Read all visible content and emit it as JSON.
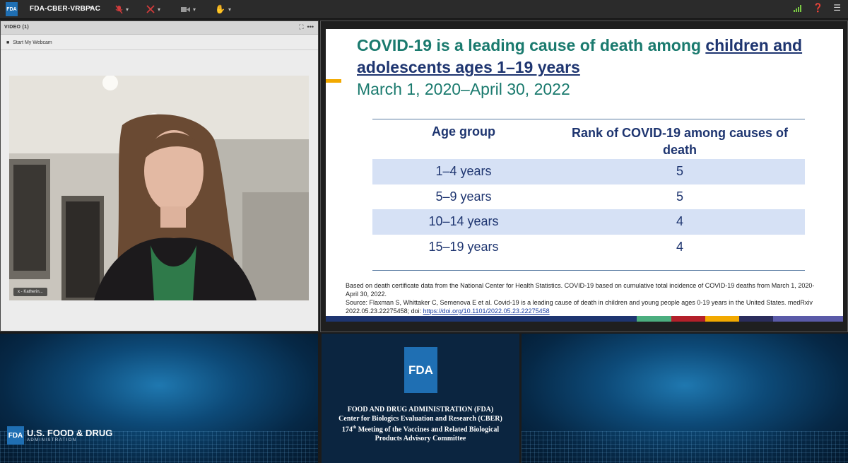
{
  "toolbar": {
    "room_name": "FDA-CBER-VRBPAC",
    "logo_text": "FDA",
    "icons": [
      "mic-muted-icon",
      "camera-muted-icon",
      "webcam-icon",
      "raise-hand-icon",
      "signal-icon",
      "help-icon",
      "menu-icon"
    ]
  },
  "video_pod": {
    "title": "VIDEO (1)",
    "start_webcam": "Start My Webcam",
    "speaker_name": "x - Katherin..."
  },
  "slide": {
    "title_part1": "COVID-19 is a leading cause of death among ",
    "title_part2": "children and adolescents ages 1–19 years",
    "subtitle": "March 1, 2020–April 30, 2022",
    "table": {
      "headers": [
        "Age group",
        "Rank of COVID-19 among causes of death"
      ],
      "rows": [
        [
          "1–4 years",
          "5"
        ],
        [
          "5–9 years",
          "5"
        ],
        [
          "10–14 years",
          "4"
        ],
        [
          "15–19 years",
          "4"
        ]
      ]
    },
    "note_line1": "Based on death certificate data from the National Center for Health Statistics. COVID-19 based on cumulative total incidence of COVID-19 deaths from March 1, 2020-April 30, 2022.",
    "note_line2": "Source: Flaxman S, Whittaker C, Semenova E et al. Covid-19 is a leading cause of death in children and young people ages 0-19 years in the United States. medRxiv 2022.05.23.22275458; doi: ",
    "note_link": "https://doi.org/10.1101/2022.05.23.22275458",
    "strip_colors": [
      "#1e3570",
      "#1e3570",
      "#4cae7f",
      "#b3202a",
      "#f2a900",
      "#2b2d5c",
      "#5a5aa8"
    ]
  },
  "branding": {
    "left_logo_box": "FDA",
    "left_logo_big": "U.S. FOOD & DRUG",
    "left_logo_small": "ADMINISTRATION",
    "center_logo": "FDA",
    "center_line1": "FOOD AND DRUG ADMINISTRATION (FDA)",
    "center_line2": "Center for Biologics Evaluation and Research (CBER)",
    "center_line3_num": "174",
    "center_line3_sup": "th",
    "center_line3_rest": " Meeting of the Vaccines and Related Biological",
    "center_line4": "Products Advisory Committee"
  }
}
